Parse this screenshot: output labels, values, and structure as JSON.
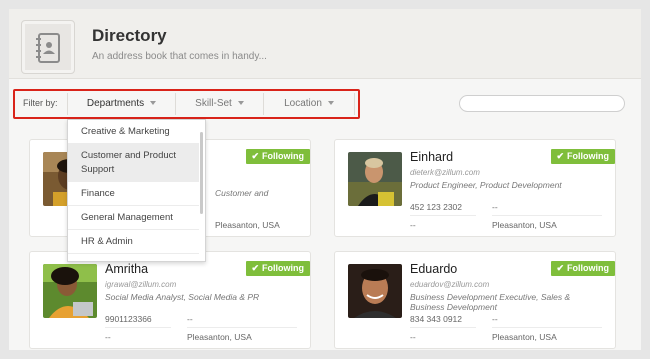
{
  "header": {
    "title": "Directory",
    "subtitle": "An address book that comes in handy...",
    "icon": "address-book-icon"
  },
  "filter": {
    "label": "Filter by:",
    "departments": "Departments",
    "skillset": "Skill-Set",
    "location": "Location",
    "search_placeholder": ""
  },
  "menu": {
    "items": [
      "Creative & Marketing",
      "Customer and Product Support",
      "Finance",
      "General Management",
      "HR & Admin"
    ],
    "active_index": 1
  },
  "cards": [
    {
      "name": "",
      "email": "",
      "role": "Customer and",
      "phone": "",
      "field_2": "",
      "field_3": "",
      "location": "Pleasanton, USA",
      "badge": "Following"
    },
    {
      "name": "Einhard",
      "email": "dieterk@zillum.com",
      "role": "Product Engineer, Product Development",
      "phone": "452 123 2302",
      "field_2": "--",
      "field_3": "--",
      "location": "Pleasanton, USA",
      "badge": "Following"
    },
    {
      "name": "Amritha",
      "email": "igrawal@zillum.com",
      "role": "Social Media Analyst, Social Media & PR",
      "phone": "9901123366",
      "field_2": "--",
      "field_3": "--",
      "location": "Pleasanton, USA",
      "badge": "Following"
    },
    {
      "name": "Eduardo",
      "email": "eduardov@zillum.com",
      "role": "Business Development Executive, Sales & Business Development",
      "phone": "834 343 0912",
      "field_2": "--",
      "field_3": "--",
      "location": "Pleasanton, USA",
      "badge": "Following"
    }
  ],
  "colors": {
    "accent_green": "#7fbe3b",
    "highlight_red": "#d9241a"
  }
}
